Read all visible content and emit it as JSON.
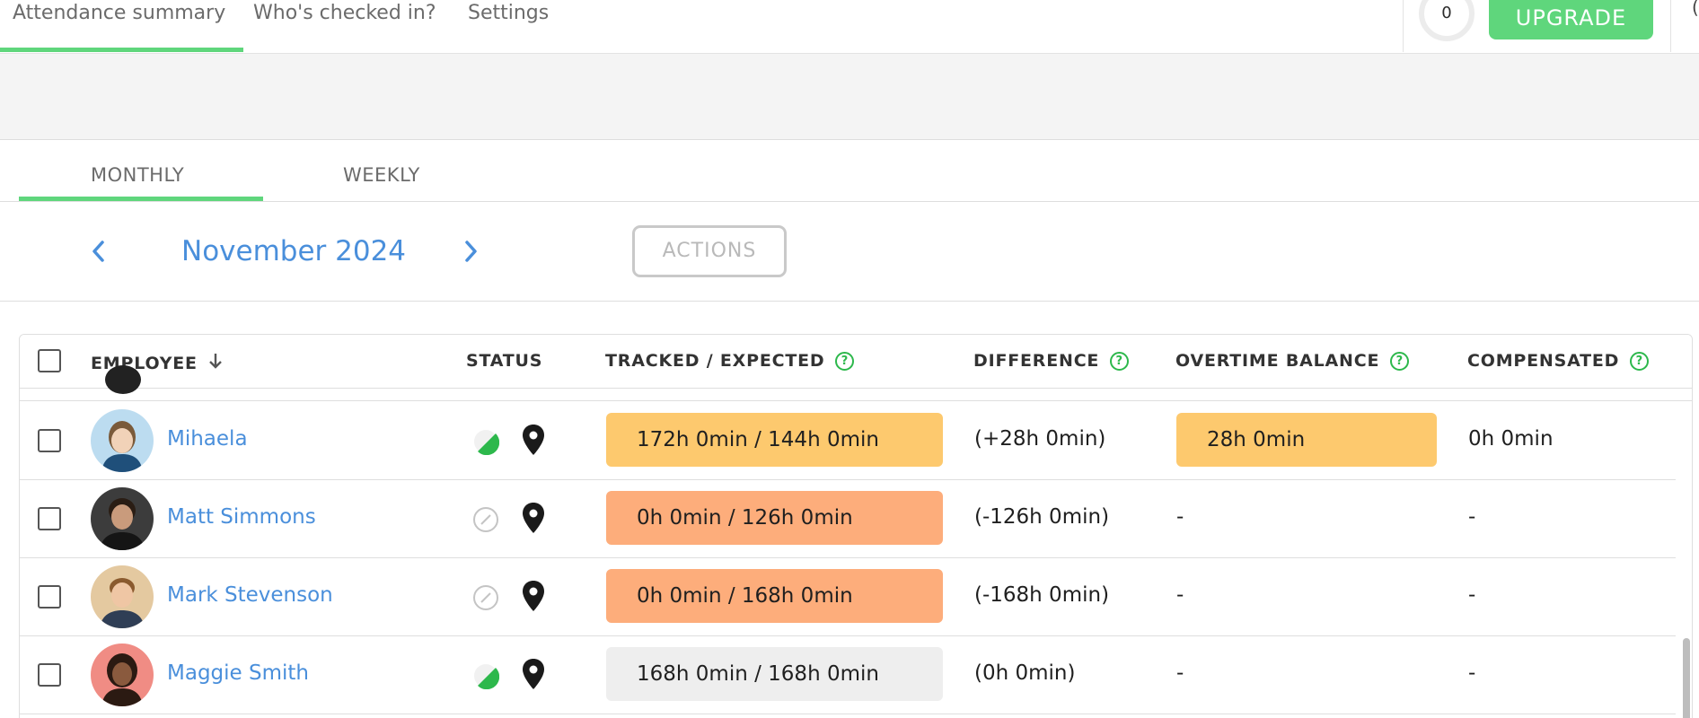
{
  "nav": {
    "tabs": [
      "Attendance summary",
      "Who's checked in?",
      "Settings"
    ],
    "counter": "0",
    "upgrade_label": "UPGRADE",
    "edge_glyph": "("
  },
  "period_tabs": [
    "MONTHLY",
    "WEEKLY"
  ],
  "month_nav": {
    "prev_icon": "chevron-left-icon",
    "next_icon": "chevron-right-icon",
    "month": "November 2024",
    "actions_label": "ACTIONS"
  },
  "table": {
    "columns": {
      "employee": "EMPLOYEE",
      "status": "STATUS",
      "tracked": "TRACKED / EXPECTED",
      "difference": "DIFFERENCE",
      "overtime": "OVERTIME BALANCE",
      "compensated": "COMPENSATED"
    },
    "rows": [
      {
        "name": "Mihaela",
        "status": "in-progress",
        "tracked": "172h 0min / 144h 0min",
        "tracked_level": "over",
        "difference": "(+28h 0min)",
        "overtime": "28h 0min",
        "compensated": "0h 0min"
      },
      {
        "name": "Matt Simmons",
        "status": "none",
        "tracked": "0h 0min / 126h 0min",
        "tracked_level": "under",
        "difference": "(-126h 0min)",
        "overtime": "-",
        "compensated": "-"
      },
      {
        "name": "Mark Stevenson",
        "status": "none",
        "tracked": "0h 0min / 168h 0min",
        "tracked_level": "under",
        "difference": "(-168h 0min)",
        "overtime": "-",
        "compensated": "-"
      },
      {
        "name": "Maggie Smith",
        "status": "in-progress",
        "tracked": "168h 0min / 168h 0min",
        "tracked_level": "even",
        "difference": "(0h 0min)",
        "overtime": "-",
        "compensated": "-"
      }
    ]
  },
  "colors": {
    "accent_green": "#5fd67c",
    "link_blue": "#4a8fdb",
    "over_yellow": "#fdc96e",
    "under_orange": "#fdad7b",
    "even_grey": "#eeeeee"
  }
}
